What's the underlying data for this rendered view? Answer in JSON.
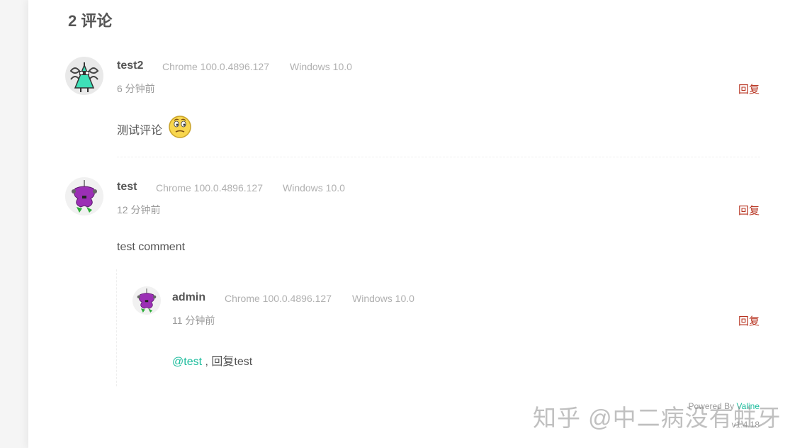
{
  "header": {
    "count_title": "2 评论"
  },
  "comments": [
    {
      "nick": "test2",
      "browser": "Chrome 100.0.4896.127",
      "os": "Windows 10.0",
      "time": "6 分钟前",
      "reply_label": "回复",
      "text": "测试评论",
      "emoji": "thinking-emoji"
    },
    {
      "nick": "test",
      "browser": "Chrome 100.0.4896.127",
      "os": "Windows 10.0",
      "time": "12 分钟前",
      "reply_label": "回复",
      "text": "test comment",
      "children": [
        {
          "nick": "admin",
          "browser": "Chrome 100.0.4896.127",
          "os": "Windows 10.0",
          "time": "11 分钟前",
          "reply_label": "回复",
          "at": "@test",
          "text": " , 回复test"
        }
      ]
    }
  ],
  "footer": {
    "powered_prefix": "Powered By",
    "powered_name": "Valine",
    "version": "v1.4.18"
  },
  "watermark": "知乎 @中二病没有蛀牙",
  "colors": {
    "accent": "#1abc9c",
    "reply": "#b7321f"
  }
}
